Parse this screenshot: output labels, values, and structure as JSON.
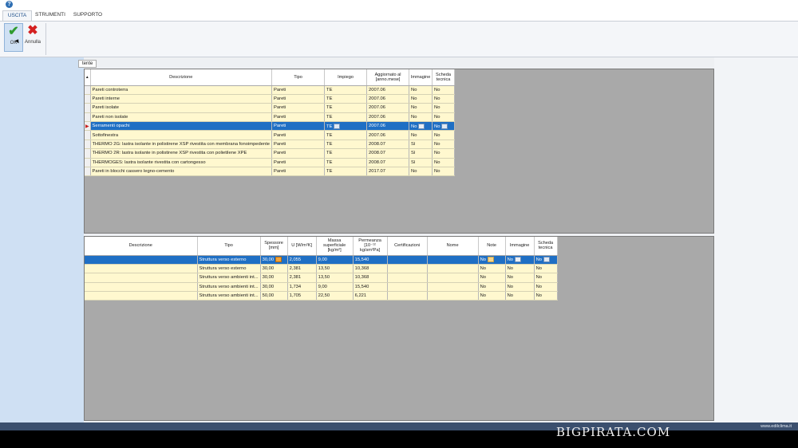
{
  "help_icon": "?",
  "tabs": [
    {
      "label": "USCITA",
      "active": true
    },
    {
      "label": "STRUMENTI",
      "active": false
    },
    {
      "label": "SUPPORTO",
      "active": false
    }
  ],
  "ribbon": {
    "ok_label": "OK",
    "cancel_label": "Annulla"
  },
  "subtab_label": "tente",
  "top_grid": {
    "headers": {
      "descrizione": "Descrizione",
      "tipo": "Tipo",
      "impiego": "Impiego",
      "aggiornato": "Aggiornato al [anno.mese]",
      "immagine": "Immagine",
      "scheda": "Scheda tecnica"
    },
    "rows": [
      {
        "descrizione": "Pareti controterra",
        "tipo": "Pareti",
        "impiego": "TE",
        "aggiornato": "2007.06",
        "immagine": "No",
        "scheda": "No"
      },
      {
        "descrizione": "Pareti interne",
        "tipo": "Pareti",
        "impiego": "TE",
        "aggiornato": "2007.06",
        "immagine": "No",
        "scheda": "No"
      },
      {
        "descrizione": "Pareti isolate",
        "tipo": "Pareti",
        "impiego": "TE",
        "aggiornato": "2007.06",
        "immagine": "No",
        "scheda": "No"
      },
      {
        "descrizione": "Pareti non isolate",
        "tipo": "Pareti",
        "impiego": "TE",
        "aggiornato": "2007.06",
        "immagine": "No",
        "scheda": "No"
      },
      {
        "descrizione": "Serramenti opachi",
        "tipo": "Pareti",
        "impiego": "TE",
        "aggiornato": "2007.06",
        "immagine": "No",
        "scheda": "No"
      },
      {
        "descrizione": "Sottofinestra",
        "tipo": "Pareti",
        "impiego": "TE",
        "aggiornato": "2007.06",
        "immagine": "No",
        "scheda": "No"
      },
      {
        "descrizione": "THERMO 2G: lastra isolante in polistirene XSP rivestita con membrana fonoimpedente",
        "tipo": "Pareti",
        "impiego": "TE",
        "aggiornato": "2008.07",
        "immagine": "Sì",
        "scheda": "No"
      },
      {
        "descrizione": "THERMO 2R: lastra isolante in polistirene XSP rivestita con polietilene XPE",
        "tipo": "Pareti",
        "impiego": "TE",
        "aggiornato": "2008.07",
        "immagine": "Sì",
        "scheda": "No"
      },
      {
        "descrizione": "THERMOGES: lastra isolante rivestita con cartongesso",
        "tipo": "Pareti",
        "impiego": "TE",
        "aggiornato": "2008.07",
        "immagine": "Sì",
        "scheda": "No"
      },
      {
        "descrizione": "Pareti in blocchi cassero legno-cemento",
        "tipo": "Pareti",
        "impiego": "TE",
        "aggiornato": "2017.07",
        "immagine": "No",
        "scheda": "No"
      }
    ],
    "selected_index": 4
  },
  "bottom_grid": {
    "headers": {
      "descrizione": "Descrizione",
      "tipo": "Tipo",
      "spessore": "Spessore [mm]",
      "u": "U [W/m²K]",
      "massa": "Massa superficiale [kg/m²]",
      "permeanza": "Permeanza [10⁻¹² kg/sm²Pa]",
      "certificazioni": "Certificazioni",
      "nome": "Nome",
      "note": "Note",
      "immagine": "Immagine",
      "scheda": "Scheda tecnica"
    },
    "rows": [
      {
        "descrizione": "",
        "tipo": "Struttura verso esterno",
        "spessore": "30,00",
        "u": "2,055",
        "massa": "9,00",
        "permeanza": "15,540",
        "certificazioni": "",
        "nome": "",
        "note": "No",
        "immagine": "No",
        "scheda": "No"
      },
      {
        "descrizione": "",
        "tipo": "Struttura verso esterno",
        "spessore": "30,00",
        "u": "2,381",
        "massa": "13,50",
        "permeanza": "10,368",
        "certificazioni": "",
        "nome": "",
        "note": "No",
        "immagine": "No",
        "scheda": "No"
      },
      {
        "descrizione": "",
        "tipo": "Struttura verso ambienti int...",
        "spessore": "30,00",
        "u": "2,381",
        "massa": "13,50",
        "permeanza": "10,368",
        "certificazioni": "",
        "nome": "",
        "note": "No",
        "immagine": "No",
        "scheda": "No"
      },
      {
        "descrizione": "",
        "tipo": "Struttura verso ambienti int...",
        "spessore": "30,00",
        "u": "1,734",
        "massa": "9,00",
        "permeanza": "15,540",
        "certificazioni": "",
        "nome": "",
        "note": "No",
        "immagine": "No",
        "scheda": "No"
      },
      {
        "descrizione": "",
        "tipo": "Struttura verso ambienti int...",
        "spessore": "50,00",
        "u": "1,705",
        "massa": "22,50",
        "permeanza": "6,221",
        "certificazioni": "",
        "nome": "",
        "note": "No",
        "immagine": "No",
        "scheda": "No"
      }
    ],
    "selected_index": 0
  },
  "status_url": "www.edilclima.it",
  "watermark": "BIGPIRATA.COM",
  "colors": {
    "selection": "#1f6fc4",
    "row_bg": "#fff8cf",
    "grid_bg": "#a9a9a9",
    "left_panel": "#cfe0f3"
  }
}
